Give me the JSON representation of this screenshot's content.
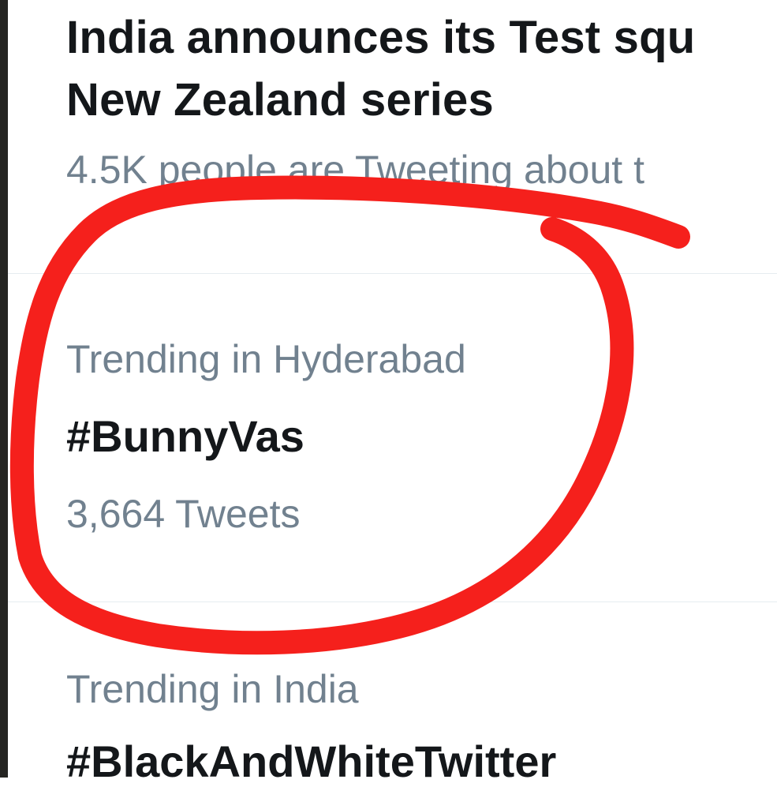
{
  "trends": [
    {
      "title_line1": "India announces its Test squ",
      "title_line2": "New Zealand series",
      "meta": "4.5K people are Tweeting about t"
    },
    {
      "context": "Trending in Hyderabad",
      "title": "#BunnyVas",
      "meta": "3,664 Tweets"
    },
    {
      "context": "Trending in India",
      "title": "#BlackAndWhiteTwitter"
    }
  ],
  "annotation": {
    "type": "freehand circle",
    "color": "#f5201c"
  }
}
